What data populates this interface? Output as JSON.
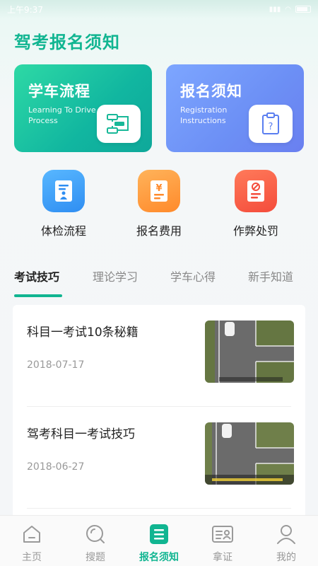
{
  "status_bar": {
    "time": "上午9:37",
    "icons": [
      "signal-icon",
      "bluetooth-icon",
      "wifi-icon",
      "battery-icon"
    ]
  },
  "page": {
    "title": "驾考报名须知"
  },
  "cards": [
    {
      "title": "学车流程",
      "subtitle_line1": "Learning To Drive",
      "subtitle_line2": "Process",
      "icon": "flowchart-icon"
    },
    {
      "title": "报名须知",
      "subtitle_line1": "Registration",
      "subtitle_line2": "Instructions",
      "icon": "clipboard-question-icon"
    }
  ],
  "quick_links": [
    {
      "label": "体检流程",
      "icon": "medical-exam-icon"
    },
    {
      "label": "报名费用",
      "icon": "fee-document-icon"
    },
    {
      "label": "作弊处罚",
      "icon": "penalty-document-icon"
    }
  ],
  "tabs": [
    {
      "label": "考试技巧",
      "active": true
    },
    {
      "label": "理论学习",
      "active": false
    },
    {
      "label": "学车心得",
      "active": false
    },
    {
      "label": "新手知道",
      "active": false
    }
  ],
  "articles": [
    {
      "title": "科目一考试10条秘籍",
      "date": "2018-07-17"
    },
    {
      "title": "驾考科目一考试技巧",
      "date": "2018-06-27"
    }
  ],
  "bottom_nav": [
    {
      "label": "主页",
      "icon": "home-icon",
      "active": false
    },
    {
      "label": "搜题",
      "icon": "search-icon",
      "active": false
    },
    {
      "label": "报名须知",
      "icon": "notice-icon",
      "active": true
    },
    {
      "label": "拿证",
      "icon": "license-icon",
      "active": false
    },
    {
      "label": "我的",
      "icon": "profile-icon",
      "active": false
    }
  ],
  "colors": {
    "accent": "#11b591",
    "card_green": "#1dc4a0",
    "card_blue": "#7096f5"
  }
}
